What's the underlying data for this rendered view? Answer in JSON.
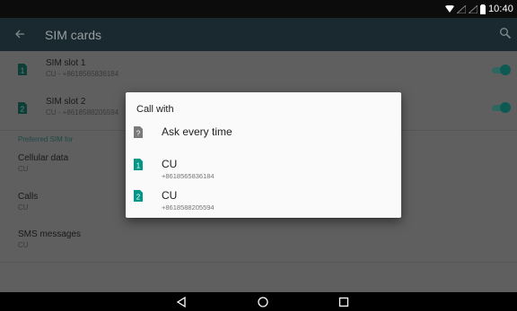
{
  "status_bar": {
    "time": "10:40"
  },
  "toolbar": {
    "title": "SIM cards",
    "back_icon": "arrow-back-icon",
    "search_icon": "search-icon"
  },
  "sim_slots": [
    {
      "number": "1",
      "title": "SIM slot 1",
      "subtitle": "CU - +8618565836184",
      "enabled": true
    },
    {
      "number": "2",
      "title": "SIM slot 2",
      "subtitle": "CU - +8618588205594",
      "enabled": true
    }
  ],
  "preferred": {
    "header": "Preferred SIM for",
    "items": [
      {
        "title": "Cellular data",
        "value": "CU"
      },
      {
        "title": "Calls",
        "value": "CU"
      },
      {
        "title": "SMS messages",
        "value": "CU"
      }
    ]
  },
  "dialog": {
    "title": "Call with",
    "options": [
      {
        "label": "Ask every time",
        "sub": "",
        "icon": "question-sim-icon"
      },
      {
        "label": "CU",
        "sub": "+8618565836184",
        "icon": "sim-1-icon",
        "number": "1"
      },
      {
        "label": "CU",
        "sub": "+8618588205594",
        "icon": "sim-2-icon",
        "number": "2"
      }
    ]
  },
  "colors": {
    "accent": "#009688",
    "dialog_bg": "#fafafa",
    "toolbar": "#1b2a30"
  },
  "nav": {
    "back_icon": "nav-back-icon",
    "home_icon": "nav-home-icon",
    "recents_icon": "nav-recents-icon"
  }
}
